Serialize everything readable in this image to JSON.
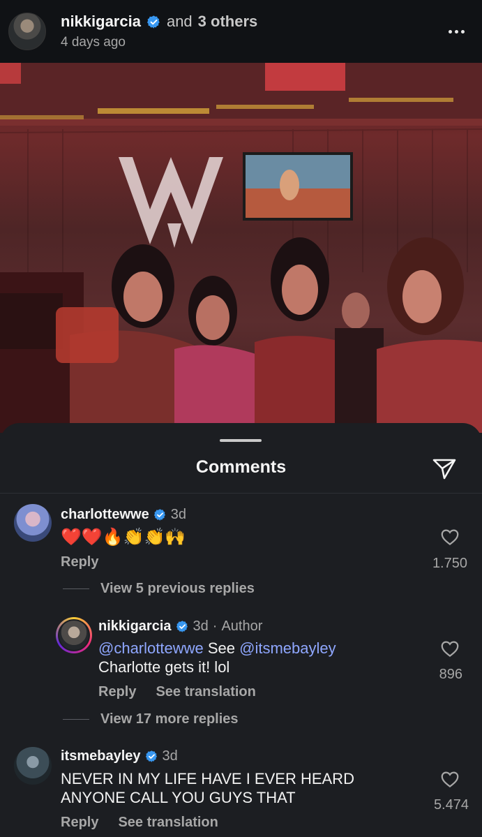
{
  "post": {
    "author": "nikkigarcia",
    "and_text": "and",
    "others": "3 others",
    "time": "4 days ago"
  },
  "comments_sheet": {
    "title": "Comments"
  },
  "comments": [
    {
      "username": "charlottewwe",
      "time": "3d",
      "text": "❤️❤️🔥👏👏🙌",
      "reply_label": "Reply",
      "likes": "1.750"
    },
    {
      "username": "nikkigarcia",
      "time": "3d",
      "author_tag": "Author",
      "mention1": "@charlottewwe",
      "text_mid": " See ",
      "mention2": "@itsmebayley",
      "text_line2": "Charlotte gets it! lol",
      "reply_label": "Reply",
      "translation_label": "See translation",
      "likes": "896"
    },
    {
      "username": "itsmebayley",
      "time": "3d",
      "text_line1": "NEVER IN MY LIFE HAVE I EVER HEARD",
      "text_line2": "ANYONE CALL YOU GUYS THAT",
      "reply_label": "Reply",
      "translation_label": "See translation",
      "likes": "5.474"
    }
  ],
  "view_previous_replies": "View 5 previous replies",
  "view_more_replies": "View 17 more replies",
  "colors": {
    "background": "#1c1e22",
    "header_bg": "#101215",
    "verified_blue": "#3897f0",
    "mention_blue": "#8fa7ff",
    "muted_text": "#a7a7a7"
  },
  "icons": [
    "verified-badge-icon",
    "more-options-icon",
    "share-icon",
    "heart-icon"
  ]
}
